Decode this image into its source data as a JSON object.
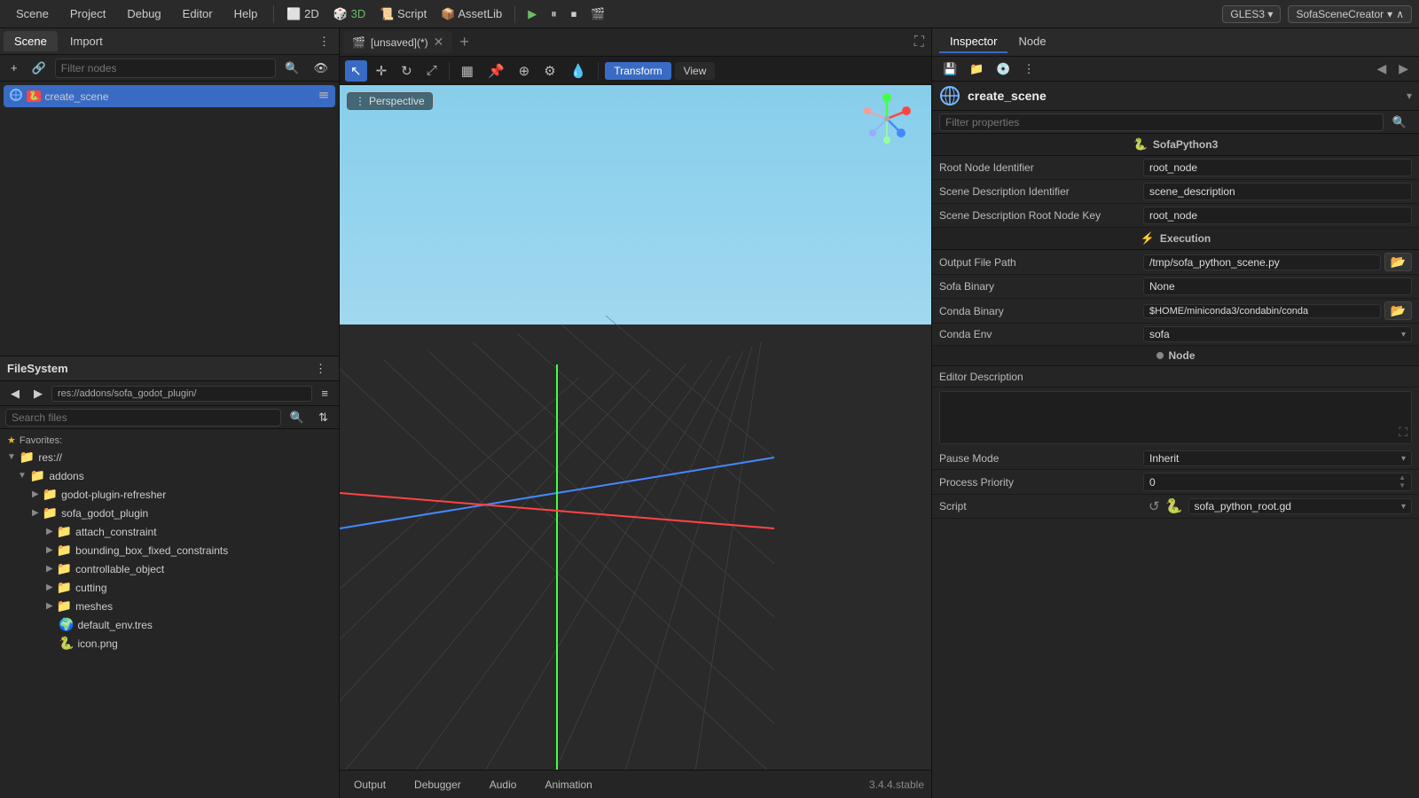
{
  "menubar": {
    "items": [
      "Scene",
      "Project",
      "Debug",
      "Editor",
      "Help"
    ],
    "play_btn": "▶",
    "pause_btn": "⏸",
    "stop_btn": "⏹",
    "movie_btn": "🎬",
    "gles_label": "GLES3",
    "scene_creator_label": "SofaSceneCreator",
    "dropdown_arrow": "▾",
    "chevron_up": "∧"
  },
  "scene_panel": {
    "tabs": [
      "Scene",
      "Import"
    ],
    "filter_placeholder": "Filter nodes",
    "root_node_name": "create_scene",
    "add_icon": "+",
    "link_icon": "🔗",
    "search_icon": "🔍",
    "eye_icon": "👁"
  },
  "filesystem": {
    "title": "FileSystem",
    "path": "res://addons/sofa_godot_plugin/",
    "search_placeholder": "Search files",
    "favorites_label": "Favorites:",
    "tree": [
      {
        "indent": 0,
        "type": "folder",
        "open": true,
        "name": "res://",
        "level": 1
      },
      {
        "indent": 1,
        "type": "folder",
        "open": true,
        "name": "addons",
        "level": 2
      },
      {
        "indent": 2,
        "type": "folder",
        "open": false,
        "name": "godot-plugin-refresher",
        "level": 3
      },
      {
        "indent": 2,
        "type": "folder",
        "open": false,
        "name": "sofa_godot_plugin",
        "level": 3
      },
      {
        "indent": 3,
        "type": "folder",
        "open": false,
        "name": "attach_constraint",
        "level": 4
      },
      {
        "indent": 3,
        "type": "folder",
        "open": false,
        "name": "bounding_box_fixed_constraints",
        "level": 4
      },
      {
        "indent": 3,
        "type": "folder",
        "open": false,
        "name": "controllable_object",
        "level": 4
      },
      {
        "indent": 3,
        "type": "folder",
        "open": false,
        "name": "cutting",
        "level": 4
      },
      {
        "indent": 3,
        "type": "folder",
        "open": false,
        "name": "meshes",
        "level": 4
      },
      {
        "indent": 3,
        "type": "file",
        "name": "default_env.tres",
        "icon": "🌍",
        "level": 4
      },
      {
        "indent": 3,
        "type": "file",
        "name": "icon.png",
        "icon": "🐍",
        "level": 4
      }
    ]
  },
  "viewport": {
    "tab_name": "[unsaved](*)",
    "perspective_label": "Perspective",
    "toolbar_tools": [
      "↖",
      "↕",
      "↻",
      "⤢",
      "▦",
      "📌",
      "⊕",
      "⚙",
      "💧"
    ],
    "view_buttons": [
      "Transform",
      "View"
    ],
    "bottom_tabs": [
      "Output",
      "Debugger",
      "Audio",
      "Animation"
    ],
    "version": "3.4.4.stable"
  },
  "inspector": {
    "tabs": [
      "Inspector",
      "Node"
    ],
    "node_name": "create_scene",
    "filter_placeholder": "Filter properties",
    "sofapython_label": "SofaPython3",
    "execution_label": "Execution",
    "node_label": "Node",
    "properties": [
      {
        "name": "Root Node Identifier",
        "value": "root_node",
        "type": "text"
      },
      {
        "name": "Scene Description Identifier",
        "value": "scene_description",
        "type": "text"
      },
      {
        "name": "Scene Description Root Node Key",
        "value": "root_node",
        "type": "text"
      },
      {
        "name": "Output File Path",
        "value": "/tmp/sofa_python_scene.py",
        "type": "file"
      },
      {
        "name": "Sofa Binary",
        "value": "None",
        "type": "text"
      },
      {
        "name": "Conda Binary",
        "value": "$HOME/miniconda3/condabin/conda",
        "type": "file"
      },
      {
        "name": "Conda Env",
        "value": "sofa",
        "type": "dropdown"
      },
      {
        "name": "Editor Description",
        "value": "",
        "type": "textarea"
      },
      {
        "name": "Pause Mode",
        "value": "Inherit",
        "type": "dropdown"
      },
      {
        "name": "Process Priority",
        "value": "0",
        "type": "number"
      },
      {
        "name": "Script",
        "value": "sofa_python_root.gd",
        "type": "script"
      }
    ]
  }
}
